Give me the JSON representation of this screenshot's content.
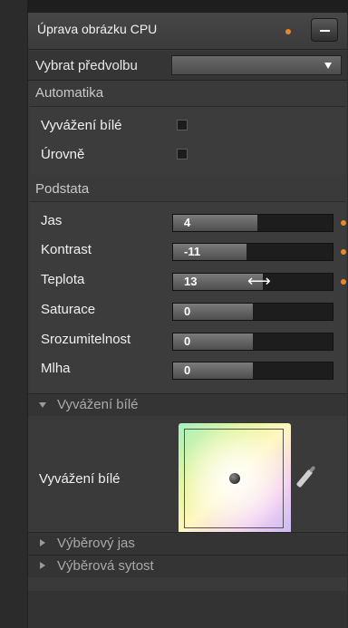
{
  "panel": {
    "title": "Úprava obrázku CPU",
    "accent_color": "#e8882c",
    "minimize_icon": "minus-icon"
  },
  "preset": {
    "label": "Vybrat předvolbu",
    "value": ""
  },
  "automatika": {
    "heading": "Automatika",
    "items": [
      {
        "label": "Vyvážení bílé",
        "checked": false
      },
      {
        "label": "Úrovně",
        "checked": false
      }
    ]
  },
  "podstata": {
    "heading": "Podstata",
    "sliders": [
      {
        "label": "Jas",
        "value": "4",
        "fill": 0.53,
        "modified": true
      },
      {
        "label": "Kontrast",
        "value": "-11",
        "fill": 0.46,
        "modified": true
      },
      {
        "label": "Teplota",
        "value": "13",
        "fill": 0.56,
        "modified": true
      },
      {
        "label": "Saturace",
        "value": "0",
        "fill": 0.5,
        "modified": false
      },
      {
        "label": "Srozumitelnost",
        "value": "0",
        "fill": 0.5,
        "modified": false
      },
      {
        "label": "Mlha",
        "value": "0",
        "fill": 0.5,
        "modified": false
      }
    ]
  },
  "white_balance": {
    "heading": "Vyvážení bílé",
    "label": "Vyvážení bílé",
    "picker_icon": "eyedropper-icon"
  },
  "collapsed_sections": [
    {
      "heading": "Výběrový jas"
    },
    {
      "heading": "Výběrová sytost"
    }
  ]
}
